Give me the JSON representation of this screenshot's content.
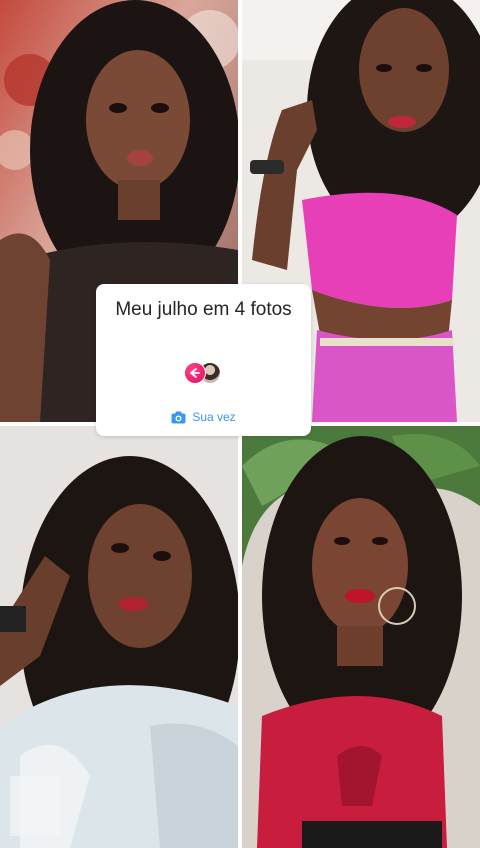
{
  "sticker": {
    "title": "Meu julho em 4 fotos",
    "action_label": "Sua vez",
    "reply_icon": "reply-arrow-icon",
    "action_icon": "camera-icon",
    "accent_color": "#3897f0",
    "avatar_color": "#e0115f"
  },
  "photos": [
    {
      "name": "photo-top-left",
      "tone": "dark-brown top, floral background"
    },
    {
      "name": "photo-top-right",
      "tone": "pink crop top"
    },
    {
      "name": "photo-bottom-left",
      "tone": "white denim jacket"
    },
    {
      "name": "photo-bottom-right",
      "tone": "red polka dot top, plants"
    }
  ]
}
